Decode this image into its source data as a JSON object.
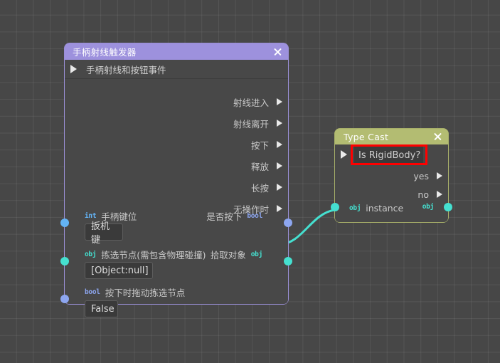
{
  "canvas": {
    "background_color": "#474747",
    "grid_color": "#5a5a5a"
  },
  "nodes": [
    {
      "id": "handle-ray-trigger",
      "title": "手柄射线触发器",
      "title_color": "#9d91dd",
      "close_icon": "close-icon",
      "exec_header": {
        "label": "手柄射线和按钮事件",
        "icon": "play-triangle-icon"
      },
      "exec_outputs": [
        {
          "label": "射线进入"
        },
        {
          "label": "射线离开"
        },
        {
          "label": "按下"
        },
        {
          "label": "释放"
        },
        {
          "label": "长按"
        },
        {
          "label": "无操作时"
        }
      ],
      "data_outputs": [
        {
          "label": "是否按下",
          "type": "bool",
          "color": "#8da6f0"
        },
        {
          "label": "拾取对象",
          "type": "obj",
          "color": "#45e0d0"
        }
      ],
      "data_inputs": [
        {
          "type": "int",
          "type_color": "#63b3f5",
          "label": "手柄键位",
          "value": "扳机键"
        },
        {
          "type": "obj",
          "type_color": "#45e0d0",
          "label": "拣选节点(需包含物理碰撞)",
          "value": "[Object:null]"
        },
        {
          "type": "bool",
          "type_color": "#8da6f0",
          "label": "按下时拖动拣选节点",
          "value": "False"
        }
      ]
    },
    {
      "id": "type-cast",
      "title": "Type Cast",
      "title_color": "#b3bc72",
      "close_icon": "close-icon",
      "question": "Is RigidBody?",
      "highlight_color": "#ff0000",
      "exec_outputs": [
        {
          "label": "yes"
        },
        {
          "label": "no"
        }
      ],
      "instance_row": {
        "in_type": "obj",
        "label": "instance",
        "out_type": "obj",
        "color": "#45e0d0"
      }
    }
  ],
  "wire": {
    "color": "#45e0d0",
    "from": "拾取对象",
    "to": "instance"
  }
}
